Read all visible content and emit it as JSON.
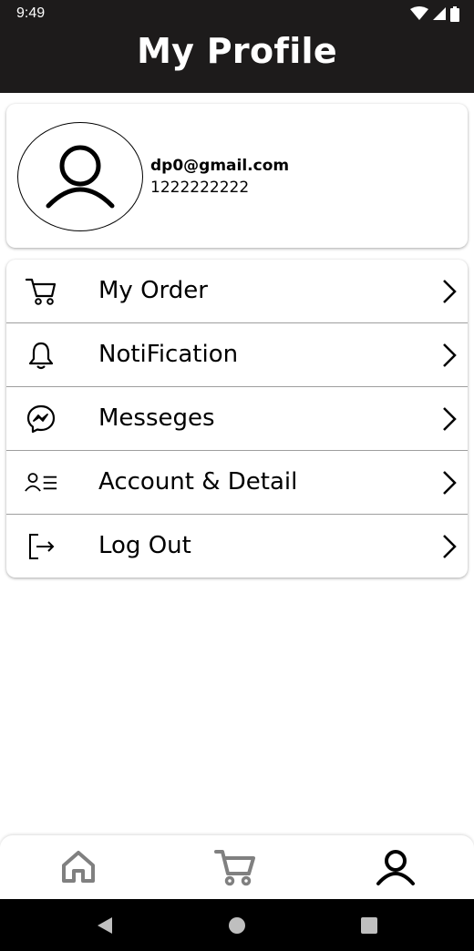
{
  "status_bar": {
    "time": "9:49"
  },
  "header": {
    "title": "My Profile"
  },
  "profile": {
    "email": "dp0@gmail.com",
    "phone": "1222222222",
    "avatar_icon": "user-icon"
  },
  "menu": {
    "items": [
      {
        "label": "My Order",
        "icon": "cart-icon"
      },
      {
        "label": "NotiFication",
        "icon": "bell-icon"
      },
      {
        "label": "Messeges",
        "icon": "messenger-icon"
      },
      {
        "label": "Account & Detail",
        "icon": "account-list-icon"
      },
      {
        "label": "Log Out",
        "icon": "logout-icon"
      }
    ]
  },
  "bottom_nav": {
    "items": [
      {
        "icon": "home-icon",
        "active": false
      },
      {
        "icon": "cart-icon",
        "active": false
      },
      {
        "icon": "profile-icon",
        "active": true
      }
    ]
  },
  "colors": {
    "header_bg": "#1d1b1b",
    "active_nav": "#000000",
    "inactive_nav": "#808080"
  }
}
